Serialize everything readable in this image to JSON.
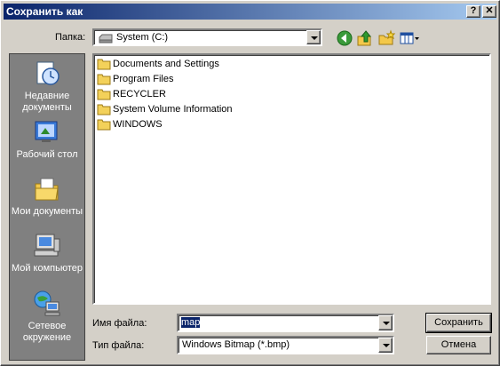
{
  "window": {
    "title": "Сохранить как",
    "help_label": "?",
    "close_label": "✕"
  },
  "folder_row": {
    "label": "Папка:",
    "current": "System (C:)"
  },
  "toolbar": {
    "icons": [
      "back-icon",
      "up-folder-icon",
      "new-folder-icon",
      "view-menu-icon"
    ]
  },
  "places": [
    {
      "label": "Недавние документы",
      "icon": "recent-documents-icon"
    },
    {
      "label": "Рабочий стол",
      "icon": "desktop-icon"
    },
    {
      "label": "Мои документы",
      "icon": "my-documents-icon"
    },
    {
      "label": "Мой компьютер",
      "icon": "my-computer-icon"
    },
    {
      "label": "Сетевое окружение",
      "icon": "network-icon"
    }
  ],
  "files": [
    {
      "name": "Documents and Settings"
    },
    {
      "name": "Program Files"
    },
    {
      "name": "RECYCLER"
    },
    {
      "name": "System Volume Information"
    },
    {
      "name": "WINDOWS"
    }
  ],
  "filename": {
    "label": "Имя файла:",
    "value": "map"
  },
  "filetype": {
    "label": "Тип файла:",
    "value": "Windows Bitmap (*.bmp)"
  },
  "buttons": {
    "save": "Сохранить",
    "cancel": "Отмена"
  },
  "colors": {
    "titlebar_start": "#0a246a",
    "titlebar_end": "#a6caf0",
    "face": "#d4d0c8",
    "places_bg": "#808080"
  }
}
